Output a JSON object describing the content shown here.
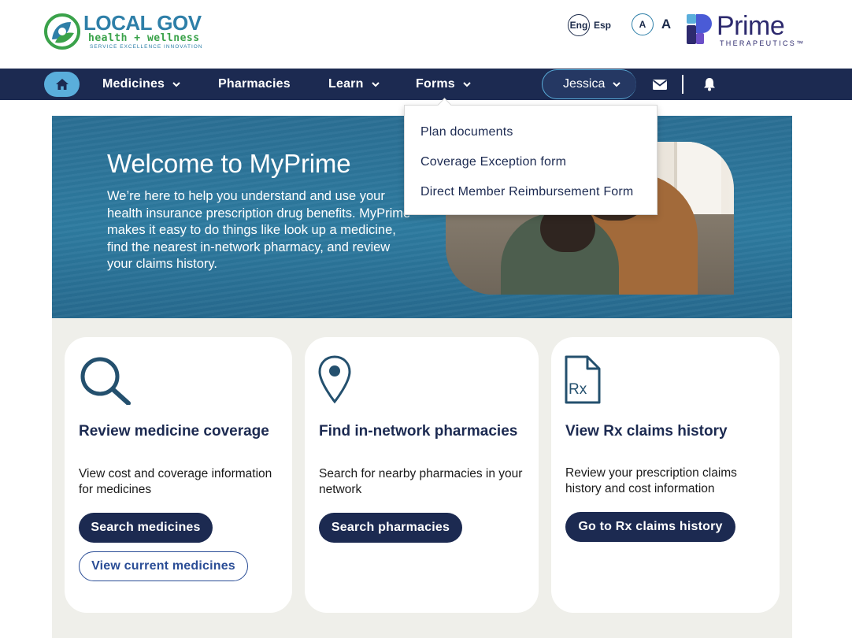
{
  "header": {
    "logo_left": {
      "title": "LOCAL GOV",
      "subtitle": "health + wellness",
      "tagline": "SERVICE  EXCELLENCE  INNOVATION"
    },
    "language": {
      "english": "Eng",
      "spanish": "Esp"
    },
    "font_size": {
      "small": "A",
      "large": "A"
    },
    "logo_right": {
      "title": "Prime",
      "subtitle": "THERAPEUTICS™"
    }
  },
  "nav": {
    "items": [
      {
        "label": "Medicines",
        "has_dropdown": true
      },
      {
        "label": "Pharmacies",
        "has_dropdown": false
      },
      {
        "label": "Learn",
        "has_dropdown": true
      },
      {
        "label": "Forms",
        "has_dropdown": true
      }
    ],
    "user": {
      "name": "Jessica"
    },
    "icons": {
      "home": "home-icon",
      "mail": "mail-icon",
      "bell": "bell-icon"
    }
  },
  "forms_dropdown": {
    "items": [
      "Plan documents",
      "Coverage Exception form",
      "Direct Member Reimbursement Form"
    ]
  },
  "hero": {
    "title": "Welcome to MyPrime",
    "text": "We’re here to help you understand and use your health insurance prescription drug benefits. MyPrime makes it easy to do things like look up a medicine, find the nearest in-network pharmacy, and review your claims history."
  },
  "cards": [
    {
      "icon": "search-icon",
      "title": "Review medicine coverage",
      "description": "View cost and coverage information for medicines",
      "primary_button": "Search medicines",
      "secondary_button": "View current medicines"
    },
    {
      "icon": "location-pin-icon",
      "title": "Find in-network pharmacies",
      "description": "Search for nearby pharmacies in your network",
      "primary_button": "Search pharmacies"
    },
    {
      "icon": "rx-document-icon",
      "title": "View Rx claims history",
      "icon_text": "Rx",
      "description": "Review your prescription claims history and cost information",
      "primary_button": "Go to Rx claims history"
    }
  ],
  "colors": {
    "navy": "#1c2a51",
    "sky": "#5aaedb",
    "hero_teal": "#2e7ba0",
    "card_bg": "#efefea",
    "green": "#3aa24a"
  }
}
